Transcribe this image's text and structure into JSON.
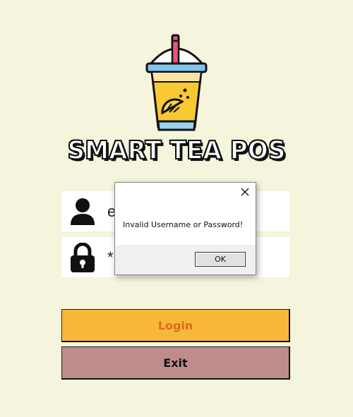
{
  "app": {
    "title": "SMART TEA POS",
    "logo_icon": "bubble-tea-cup-icon"
  },
  "login_form": {
    "username": {
      "icon": "user-icon",
      "value": "e"
    },
    "password": {
      "icon": "lock-icon",
      "value": "*"
    },
    "login_label": "Login",
    "exit_label": "Exit"
  },
  "dialog": {
    "message": "Invalid Username or Password!",
    "ok_label": "OK",
    "close_icon": "close-icon"
  },
  "colors": {
    "background": "#f5f4dc",
    "login_button": "#f7b83a",
    "login_text": "#e06a1c",
    "exit_button": "#bd8d8b"
  }
}
